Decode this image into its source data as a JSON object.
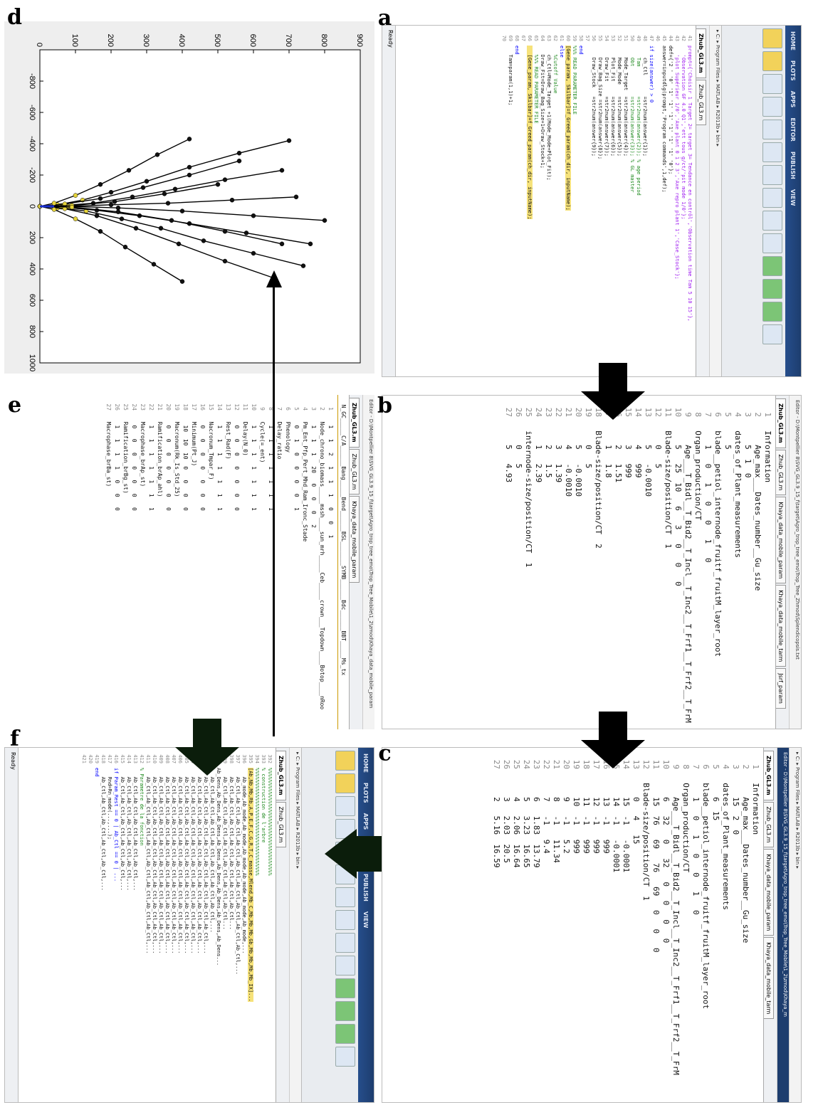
{
  "labels": {
    "a": "a",
    "b": "b",
    "c": "c",
    "d": "d",
    "e": "e",
    "f": "f"
  },
  "panel_a": {
    "ribbon_tabs": [
      "HOME",
      "PLOTS",
      "APPS",
      "EDITOR",
      "PUBLISH",
      "VIEW"
    ],
    "address": "▸ C: ▸ Program Files ▸ MATLAB ▸ R2013b ▸ bin ▸",
    "tabs": [
      "Zhub_GL3.m",
      "Zhub_GL3.m"
    ],
    "status": "Ready",
    "lines": [
      {
        "n": "41",
        "t": "prompt={'Choisir 1 Target 2= target 3= Tendance en contrôl','Observation time Tam 5 10 15'},",
        "c": "str"
      },
      {
        "n": "42",
        "t": "   'Observation GF 4.0 Q1','ett tous g/ct/'pit mode 1/0'};",
        "c": "str"
      },
      {
        "n": "43",
        "t": "   'plot Supérieur 1/0','Axe plant 0 1 2 3','Axe repro plant 1','Case_Stock'};",
        "c": "str"
      },
      {
        "n": "44",
        "t": "def={'2 ' '0' '1' '1' '1' '1' '1' '1' '0'};",
        "c": ""
      },
      {
        "n": "45",
        "t": "answer=inputdlg(prompt,'Program commands',1,def);",
        "c": ""
      },
      {
        "n": "46",
        "t": "",
        "c": ""
      },
      {
        "n": "47",
        "t": "if size(answer) > 0",
        "c": "kw"
      },
      {
        "n": "48",
        "t": "    ch_Ctl       =str2num(answer{1});",
        "c": ""
      },
      {
        "n": "49",
        "t": "    Tam          =str2num(answer{2}); % age period",
        "c": "cm"
      },
      {
        "n": "50",
        "t": "    Obt          =str2num(answer{3}); % GL master",
        "c": "cm"
      },
      {
        "n": "51",
        "t": "    Mode_Target  =str2num(answer{4});",
        "c": ""
      },
      {
        "n": "52",
        "t": "    Mode_Mode    =str2num(answer{5});",
        "c": ""
      },
      {
        "n": "53",
        "t": "    Plot_Fit     =str2num(answer{6});",
        "c": ""
      },
      {
        "n": "54",
        "t": "    Draw_Fit     =str2num(answer{7});",
        "c": ""
      },
      {
        "n": "55",
        "t": "    Draw_Bag_Size =str2num(answer{8});",
        "c": ""
      },
      {
        "n": "56",
        "t": "    Draw_Stock   =str2num(answer{9});",
        "c": ""
      },
      {
        "n": "57",
        "t": "",
        "c": ""
      },
      {
        "n": "58",
        "t": "end",
        "c": "kw"
      },
      {
        "n": "59",
        "t": "%%% READ PARAMETER FILE",
        "c": "cm"
      },
      {
        "n": "60",
        "t": "[Gene_param, Skilbar]=f_Greed_param(ch_dir, inputName);",
        "c": "hl"
      },
      {
        "n": "61",
        "t": "else",
        "c": "kw"
      },
      {
        "n": "62",
        "t": "   %Cutoff Value",
        "c": "cm"
      },
      {
        "n": "63",
        "t": "   ch_Ctl=Mode_Target +1(Mode_Mode+Plot_Fit);",
        "c": ""
      },
      {
        "n": "64",
        "t": "   Draw_Fit=Draw_Bag_Size+1+Draw_Stock+1;",
        "c": ""
      },
      {
        "n": "65",
        "t": "   %%% READ PARAMETER FILE",
        "c": "cm"
      },
      {
        "n": "66",
        "t": "   [Gene_param, Skilbar]=f_Greed_param(ch_dir, inputName);",
        "c": "hl"
      },
      {
        "n": "67",
        "t": "",
        "c": ""
      },
      {
        "n": "68",
        "t": "end",
        "c": "kw"
      },
      {
        "n": "69",
        "t": "   Tam=param(1,1)+1;",
        "c": ""
      },
      {
        "n": "70",
        "t": "",
        "c": ""
      }
    ]
  },
  "panel_b": {
    "title": "Editor - D:\\Montpellier 8\\SVG_GL3.9_15_f\\target\\Agro_trop_tree_emo\\Trop_Tree_Zhmod\\Splendicopsis.txt",
    "tabs": [
      "Zhub_GL3.m",
      "Zhub_GL3.m",
      "Khaya_data_mobile_param",
      "Khaya_data_mobile_tarm",
      "Jsrf_param"
    ],
    "lines": [
      {
        "n": "1",
        "t": "  Information"
      },
      {
        "n": "2",
        "t": "     Age_max___Dates_number__Gu_size"
      },
      {
        "n": "3",
        "t": "     5  1  0"
      },
      {
        "n": "4",
        "t": "  dates_of_Plant_measurements"
      },
      {
        "n": "5",
        "t": "     5"
      },
      {
        "n": "6",
        "t": "  blade__petiol_internode_fruitf_fruitM_layer_root"
      },
      {
        "n": "7",
        "t": "     1   0   1   0   0   1   0"
      },
      {
        "n": "8",
        "t": "  Organ_production/CT"
      },
      {
        "n": "9",
        "t": "     Age___T_Bidl__T_Bid2__T_Incl__T_Inc2__T_Frf1__T_Frf2__T_FrM"
      },
      {
        "n": "10",
        "t": "     5   25  10   6   3   0   0   0"
      },
      {
        "n": "11",
        "t": "  Blade-size/position/CT  1"
      },
      {
        "n": "12",
        "t": "     0   5"
      },
      {
        "n": "13",
        "t": "     5   -0.0010"
      },
      {
        "n": "14",
        "t": "     4   999"
      },
      {
        "n": "15",
        "t": "     3   999"
      },
      {
        "n": "16",
        "t": "     2   1.51"
      },
      {
        "n": "17",
        "t": "     1   1.8"
      },
      {
        "n": "18",
        "t": "  Blade-size/position/CT  2"
      },
      {
        "n": "19",
        "t": "     0   5"
      },
      {
        "n": "20",
        "t": "     5   -0.0010"
      },
      {
        "n": "21",
        "t": "     4   -0.0010"
      },
      {
        "n": "22",
        "t": "     3   1.39"
      },
      {
        "n": "23",
        "t": "     2   1.5"
      },
      {
        "n": "24",
        "t": "     1   2.39"
      },
      {
        "n": "25",
        "t": "  internode-size/position/CT  1"
      },
      {
        "n": "26",
        "t": "     0   5"
      },
      {
        "n": "27",
        "t": "     5   4.93"
      }
    ]
  },
  "panel_c": {
    "title": "Editor - D:\\Montpellier 8\\SVG_GL3.9_15_f\\target\\Agro_trop_tree_emo\\Trop_Tree_Mobile\\1_2\\zmod\\Khaya_m",
    "address": "▸ C: ▸ Program Files ▸ MATLAB ▸ R2013b ▸ bin ▸",
    "tabs": [
      "Zhub_GL3.m",
      "Zhub_GL3.m",
      "Khaya_data_mobile_param",
      "Khaya_data_mobile_tarm"
    ],
    "lines": [
      {
        "n": "1",
        "t": "  Information"
      },
      {
        "n": "2",
        "t": "     Age_max___Dates_number__Gu_size"
      },
      {
        "n": "3",
        "t": "     15  2  0"
      },
      {
        "n": "4",
        "t": "  dates_of_Plant_measurements"
      },
      {
        "n": "5",
        "t": "     6  15"
      },
      {
        "n": "6",
        "t": "  blade__petiol_internode_fruitf_fruitM_layer_root"
      },
      {
        "n": "7",
        "t": "     1   0   1   0   0   1   0"
      },
      {
        "n": "8",
        "t": "  Organ_production/CT"
      },
      {
        "n": "9",
        "t": "     Age___T_Bidl__T_Bid2__T_Incl__T_Inc2__T_Frf1__T_Frf2__T_FrM"
      },
      {
        "n": "10",
        "t": "     6   32   0   32   0   0   0   0"
      },
      {
        "n": "11",
        "t": "     15  76   69   76   69   0   0   0"
      },
      {
        "n": "12",
        "t": "  Blade-size/position/CT  1"
      },
      {
        "n": "13",
        "t": "     0   4   15"
      },
      {
        "n": "14",
        "t": "     15  -1   -0.0001"
      },
      {
        "n": "15",
        "t": "     14  -1   -0.0001"
      },
      {
        "n": "16",
        "t": "     13  -1   999"
      },
      {
        "n": "17",
        "t": "     12  -1   999"
      },
      {
        "n": "18",
        "t": "     11  -1   999"
      },
      {
        "n": "19",
        "t": "     10  -1   999"
      },
      {
        "n": "20",
        "t": "     9   -1   5.2"
      },
      {
        "n": "21",
        "t": "     8   -1   11.34"
      },
      {
        "n": "22",
        "t": "     7   -1   9.4"
      },
      {
        "n": "23",
        "t": "     6   1.83  13.79"
      },
      {
        "n": "24",
        "t": "     5   3.23  16.65"
      },
      {
        "n": "25",
        "t": "     4   2.06  16.64"
      },
      {
        "n": "26",
        "t": "     3   2.03  20.5"
      },
      {
        "n": "27",
        "t": "     2   5.16  16.59"
      }
    ]
  },
  "panel_d": {
    "chart_data": {
      "type": "line",
      "title": "",
      "xlabel": "",
      "ylabel": "",
      "xlim": [
        -1000,
        1000
      ],
      "ylim": [
        0,
        900
      ],
      "xticks": [
        -800,
        -600,
        -400,
        -200,
        0,
        200,
        400,
        600,
        800,
        1000
      ],
      "yticks": [
        0,
        100,
        200,
        300,
        400,
        500,
        600,
        700,
        800,
        900
      ],
      "series": [
        {
          "x": [
            0,
            -10,
            -40,
            -90,
            -160,
            -250,
            -340,
            -420
          ],
          "y": [
            0,
            50,
            120,
            200,
            300,
            420,
            560,
            700
          ]
        },
        {
          "x": [
            0,
            10,
            30,
            80,
            140,
            220,
            300,
            380
          ],
          "y": [
            0,
            50,
            130,
            230,
            340,
            460,
            600,
            740
          ]
        },
        {
          "x": [
            0,
            -5,
            -20,
            -60,
            -110,
            -170,
            -230
          ],
          "y": [
            0,
            60,
            150,
            260,
            380,
            520,
            680
          ]
        },
        {
          "x": [
            0,
            5,
            25,
            60,
            110,
            170,
            240
          ],
          "y": [
            0,
            60,
            160,
            280,
            420,
            580,
            760
          ]
        },
        {
          "x": [
            0,
            -15,
            -50,
            -120,
            -200,
            -290
          ],
          "y": [
            0,
            70,
            170,
            290,
            420,
            560
          ]
        },
        {
          "x": [
            0,
            15,
            60,
            140,
            240,
            350,
            460
          ],
          "y": [
            0,
            70,
            160,
            270,
            390,
            520,
            660
          ]
        },
        {
          "x": [
            0,
            0,
            -10,
            -20,
            -40,
            -60
          ],
          "y": [
            0,
            80,
            200,
            360,
            540,
            720
          ]
        },
        {
          "x": [
            0,
            0,
            10,
            30,
            60,
            90
          ],
          "y": [
            0,
            80,
            220,
            400,
            600,
            800
          ]
        },
        {
          "x": [
            0,
            -20,
            -70,
            -140,
            -230,
            -330,
            -430
          ],
          "y": [
            0,
            40,
            100,
            170,
            250,
            330,
            420
          ]
        },
        {
          "x": [
            0,
            20,
            80,
            160,
            260,
            370,
            480
          ],
          "y": [
            0,
            40,
            100,
            170,
            240,
            320,
            400
          ]
        },
        {
          "x": [
            0,
            -5,
            -30,
            -80,
            -140
          ],
          "y": [
            0,
            90,
            210,
            350,
            500
          ]
        },
        {
          "x": [
            0,
            5,
            35,
            90,
            160,
            240
          ],
          "y": [
            0,
            90,
            220,
            370,
            520,
            680
          ]
        }
      ]
    }
  },
  "panel_e": {
    "title": "Editor - D:\\Montpellier 8\\SVG_GL3.9_15_f\\target\\Agro_trop_tree_emo\\Trop_Tree_Mobile\\1_2\\zmod\\Khaya_data_mobile_param",
    "tabs": [
      "Zhub_GL3.m",
      "Zhub_GL3.m",
      "Khaya_data_mobile_param"
    ],
    "header": "  N_GC_____C/A______Bang_____Bend______BSL_______SYMB______Bdc______BBT_____Ms_tx",
    "lines": [
      {
        "n": "1",
        "t": "   1   1   2   1   1   1   0   0   1"
      },
      {
        "n": "2",
        "t": "  Node_chrono_biomass_____mssh____sun_mrh_____Ceb_____crown___Topdown____Botop____nRoo"
      },
      {
        "n": "3",
        "t": "   1   1   1   20   0   0   0   2"
      },
      {
        "n": "4",
        "t": "  Pm_Ent_Pfp_Pert_Mhd_Ram_Ironc_Stade"
      },
      {
        "n": "5",
        "t": "   0   1   0   0   0   0   1"
      },
      {
        "n": "6",
        "t": "  Phenology"
      },
      {
        "n": "7",
        "t": "  Delay_ratio"
      },
      {
        "n": "8",
        "t": "   1   1   1   1   1   1   1"
      },
      {
        "n": "9",
        "t": "  Cycle(=_ent)"
      },
      {
        "n": "10",
        "t": "   1   1   1   1   1   1   1"
      },
      {
        "n": "11",
        "t": "  Delay(N_0)"
      },
      {
        "n": "12",
        "t": "   0   0   0   0   0   0   0"
      },
      {
        "n": "13",
        "t": "  Rest_Rad(F)"
      },
      {
        "n": "14",
        "t": "   1   1   1   1   1   1   1"
      },
      {
        "n": "15",
        "t": "  Nacronum_Tmpar_F)"
      },
      {
        "n": "16",
        "t": "   0   0   0   0   0   0   0"
      },
      {
        "n": "17",
        "t": "  Minimum(Pt_J)"
      },
      {
        "n": "18",
        "t": "   10  10  10  0   0   0   0"
      },
      {
        "n": "19",
        "t": "  Macronum(Rk_Is_Std_25)"
      },
      {
        "n": "20",
        "t": "   0   0   0   0   0   0   0"
      },
      {
        "n": "21",
        "t": "  Ramification_brAp_ahl)"
      },
      {
        "n": "22",
        "t": "   1   1   1   1   1   1   1"
      },
      {
        "n": "23",
        "t": "  Macrophase_brAp_st)"
      },
      {
        "n": "24",
        "t": "   0   0   0   0   0   0   0"
      },
      {
        "n": "25",
        "t": "  Ramification_brBg_st)"
      },
      {
        "n": "26",
        "t": "   1   1   1   1   0   0   0"
      },
      {
        "n": "27",
        "t": "  Macrophase_brBa_st)"
      }
    ]
  },
  "panel_f": {
    "ribbon_tabs": [
      "HOME",
      "PLOTS",
      "APPS",
      "EDITOR",
      "PUBLISH",
      "VIEW"
    ],
    "address": "▸ C: ▸ Program Files ▸ MATLAB ▸ R2013b ▸ bin ▸",
    "tabs": [
      "Zhub_GL3.m",
      "Zhub_GL3.m"
    ],
    "status": "Ready",
    "lines": [
      {
        "n": "392",
        "t": "%%%%%%%%%%%%%%%%%%%%%%%%%%%%%%%%%%%%",
        "c": "cm"
      },
      {
        "n": "393",
        "t": "% construction de l'arbre",
        "c": "cm"
      },
      {
        "n": "394",
        "t": "%%%%%%%%%%%%%%%%%%%%%%%%%%%%%%%%%%%%",
        "c": "cm"
      },
      {
        "n": "395",
        "t": "[Ab,Nb,Mb,Rb,A,P,E,F,C,G,R,T,C_masse,Mlend,Mb_C,Mb,Mb,Mb,Gb,Mb,Mb,Mb,Mb_IX]...",
        "c": "hl"
      },
      {
        "n": "396",
        "t": "   Ab_mode,Ab_mode,Ab_mode,Ab_mode,Ab_mode,Ab_mode,Ab_mode,...",
        "c": ""
      },
      {
        "n": "397",
        "t": "   Ab_Ctl,Ab_Ctl,Ab_Ctl,Ab_Ctl,Ab_Ctl,Ab_Ctl,Ab_Ctl,Ab_Ctl,Ab_Ctl,...",
        "c": ""
      },
      {
        "n": "398",
        "t": "   Ab_Ctl,Ab_Ctl,Ab_Ctl,Ab_Ctl,Ab_Ctl,Ab_Ctl,Ab_Ctl...",
        "c": ""
      },
      {
        "n": "399",
        "t": "   Ab_Ctl,Ab_Ctl,Ab_Ctl,Ab_Ctl,Ab_Ctl,Ab_Ctl,Ab_Ctl...",
        "c": ""
      },
      {
        "n": "400",
        "t": "Ab_Dens,Ab_Dens,Ab_Dens,Ab_Dens,Ab_Dens,Ab_Dens,Ab_Dens,Ab_Dens...",
        "c": ""
      },
      {
        "n": "401",
        "t": "   Ab_Ctl,Ab_Ctl,Ab_Ctl,Ab_Ctl,Ab_Ctl,Ab_Ctl,Ab_Ctl,...",
        "c": ""
      },
      {
        "n": "402",
        "t": "   Ab_Ctl,Ab_Ctl,Ab_Ctl,Ab_Ctl,Ab_Ctl,Ab_Ctl,Ab_Ctl,Ab_Ctl,...",
        "c": ""
      },
      {
        "n": "403",
        "t": "   Ab_Ctl,Ab_Ctl,Ab_Ctl,Ab_Ctl,Ab_Ctl,Ab_Ctl,Ab_Ctl,Ab_Ctl,...",
        "c": ""
      },
      {
        "n": "404",
        "t": "   Ab_Ctl,Ab_Ctl,Ab_Ctl,Ab_Ctl,Ab_Ctl,Ab_Ctl,Ab_Ctl,Ab_Ctl,...",
        "c": ""
      },
      {
        "n": "405",
        "t": "   Ab_Ctl,Ab_Ctl,Ab_Ctl,Ab_Ctl,Ab_Ctl,Ab_Ctl,Ab_Ctl,Ab_Ctl,...",
        "c": ""
      },
      {
        "n": "406",
        "t": "   Ab_Ctl,Ab_Ctl,Ab_Ctl,Ab_Ctl,Ab_Ctl,Ab_Ctl,Ab_Ctl,Ab_Ctl,...",
        "c": ""
      },
      {
        "n": "407",
        "t": "   Ab_Ctl,Ab_Ctl,Ab_Ctl,Ab_Ctl,Ab_Ctl,Ab_Ctl,Ab_Ctl,Ab_Ctl,...",
        "c": ""
      },
      {
        "n": "408",
        "t": "   Ab_Ctl,Ab_Ctl,Ab_Ctl,Ab_Ctl,Ab_Ctl,Ab_Ctl,Ab_Ctl,Ab_Ctl,...",
        "c": ""
      },
      {
        "n": "409",
        "t": "   Ab_Ctl,Ab_Ctl,Ab_Ctl,Ab_Ctl,Ab_Ctl,Ab_Ctl,Ab_Ctl,Ab_Ctl,...",
        "c": ""
      },
      {
        "n": "410",
        "t": "   Ab_Ctl,Ab_Ctl,Ab_Ctl,Ab_Ctl,Ab_Ctl,Ab_Ctl,Ab_Ctl,Ab_Ctl,...",
        "c": ""
      },
      {
        "n": "411",
        "t": "   Ab_Ctl,Ab_Ctl,Ab_Ctl,Ab_Ctl,Ab_Ctl,Ab_Ctl,Ab_Ctl,Ab_Ctl,...",
        "c": ""
      },
      {
        "n": "412",
        "t": "% Parametre de la fonction",
        "c": "cm"
      },
      {
        "n": "413",
        "t": "   Ab_Ctl,Ab_Ctl,Ab_Ctl,Ab_Ctl,Ab_Ctl,...",
        "c": ""
      },
      {
        "n": "414",
        "t": "   Ab_Ctl,Ab_Ctl,Ab_Ctl,Ab_Ctl,Ab_Ctl,...",
        "c": ""
      },
      {
        "n": "415",
        "t": "   Ab_Ctl,Ab_Ctl,Ab_Ctl,Ab_Ctl,Ab_Ctl,...",
        "c": ""
      },
      {
        "n": "416",
        "t": "if Param_Rest == 0 | Ab_Ctl == 0 | ...",
        "c": "kw"
      },
      {
        "n": "417",
        "t": "   Rnd=Rn_mode(...,...);",
        "c": ""
      },
      {
        "n": "418",
        "t": "   Ab_Ctl,Ab_Ctl,Ab_Ctl,Ab_Ctl,Ab_Ctl,...",
        "c": ""
      },
      {
        "n": "419",
        "t": "end",
        "c": "kw"
      },
      {
        "n": "420",
        "t": "",
        "c": ""
      },
      {
        "n": "421",
        "t": "",
        "c": ""
      }
    ]
  }
}
